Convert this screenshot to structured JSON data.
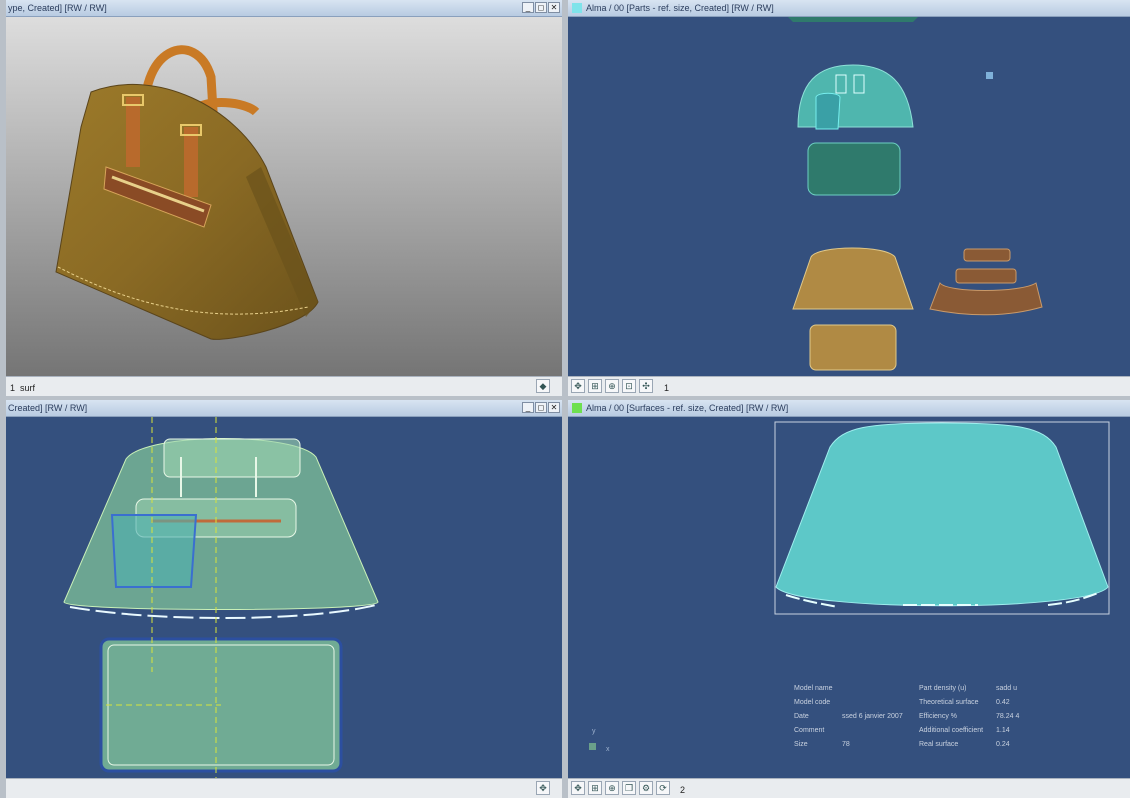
{
  "windows": {
    "top_left": {
      "title": "ype, Created] [RW / RW]",
      "status_index": "1",
      "status_name": "surf",
      "bg_color": "#d6d6d6"
    },
    "top_right": {
      "title": "Alma / 00   [Parts - ref. size, Created] [RW / RW]",
      "status_index": "1",
      "indicator_color": "#7fe3ea"
    },
    "bottom_left": {
      "title": "Created] [RW / RW]"
    },
    "bottom_right": {
      "title": "Alma / 00   [Surfaces - ref. size, Created] [RW / RW]",
      "status_index": "2",
      "indicator_color": "#6ee04f"
    }
  },
  "window_buttons": {
    "minimize": "_",
    "restore": "◻",
    "close": "✕"
  },
  "summary": {
    "rows": [
      {
        "label": "Model name",
        "value": "",
        "label2": "Part density (u)",
        "value2": "sadd u"
      },
      {
        "label": "Model code",
        "value": "",
        "label2": "Theoretical surface",
        "value2": "0.42"
      },
      {
        "label": "Date",
        "value": "ssed 6 janvier 2007",
        "label2": "Efficiency %",
        "value2": "78.24 4"
      },
      {
        "label": "Comment",
        "value": "",
        "label2": "Additional coefficient",
        "value2": "1.14"
      },
      {
        "label": "Size",
        "value": "78",
        "label2": "Real surface",
        "value2": "0.24"
      }
    ]
  },
  "axis_labels": {
    "y": "y",
    "x": "x"
  },
  "colors": {
    "canvas": "#34507e",
    "piece_tan": "#b08a44",
    "piece_brown": "#8a5a35",
    "piece_green": "#2f7a6c",
    "surface_cyan": "#5dc8c8"
  }
}
